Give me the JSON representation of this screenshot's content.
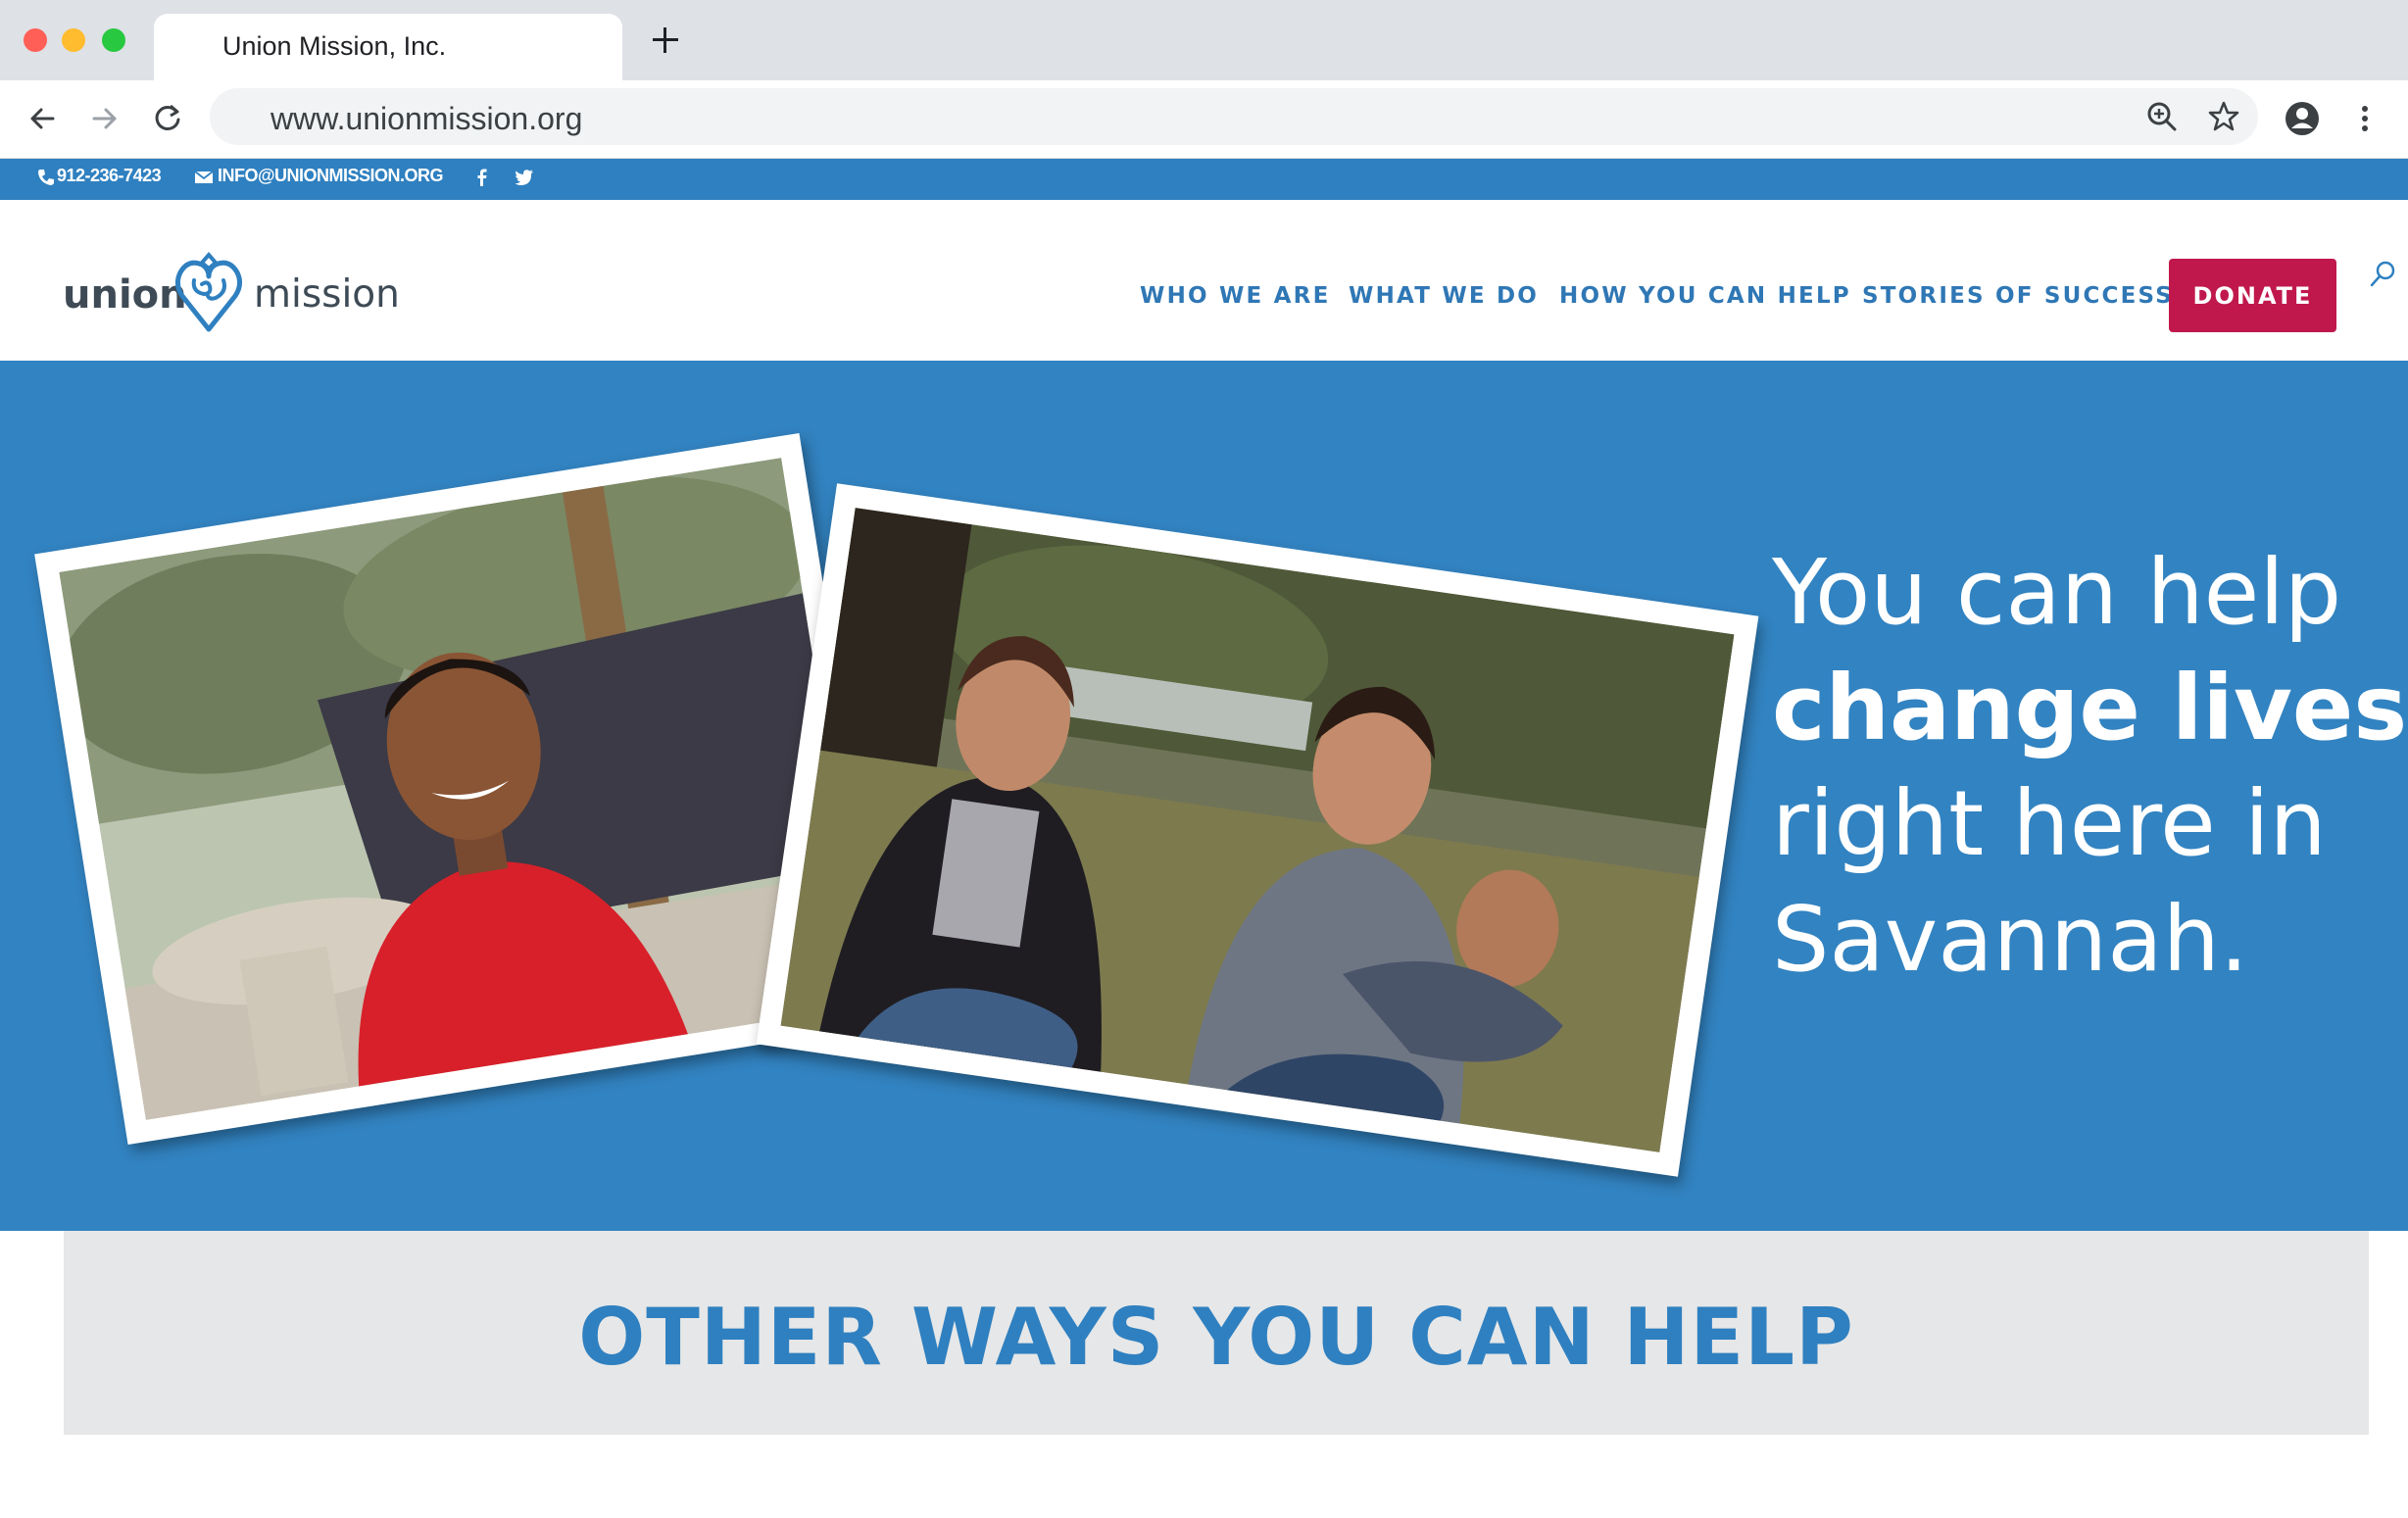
{
  "browser": {
    "tab_title": "Union Mission, Inc.",
    "url": "www.unionmission.org"
  },
  "topbar": {
    "phone": "912-236-7423",
    "email": "INFO@UNIONMISSION.ORG"
  },
  "logo": {
    "word1": "union",
    "word2": "mission"
  },
  "nav": {
    "items": [
      {
        "label": "WHO WE ARE"
      },
      {
        "label": "WHAT WE DO"
      },
      {
        "label": "HOW YOU CAN HELP"
      },
      {
        "label": "STORIES OF SUCCESS"
      }
    ],
    "donate": "DONATE"
  },
  "hero": {
    "line1": "You can help",
    "line2": "change lives",
    "line3": "right here in",
    "line4": "Savannah."
  },
  "section": {
    "title": "OTHER WAYS YOU CAN HELP"
  },
  "colors": {
    "brand_blue": "#3283c1",
    "donate_red": "#c0184d",
    "band_gray": "#e6e7e8"
  }
}
